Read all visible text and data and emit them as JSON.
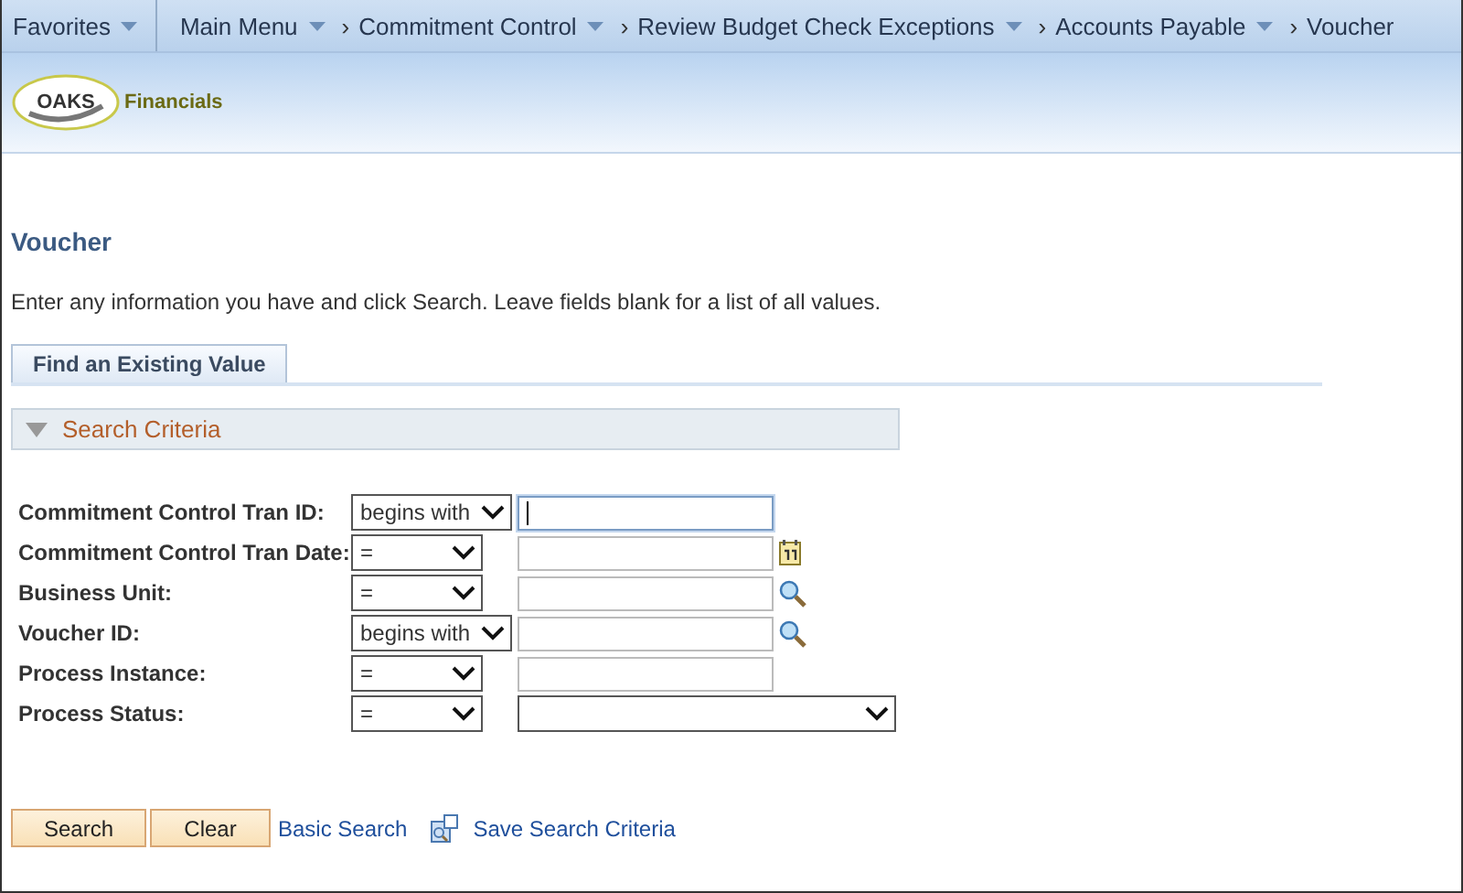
{
  "nav_bar": {
    "items": [
      {
        "label": "Favorites",
        "dropdown": true
      },
      {
        "label": "Main Menu",
        "dropdown": true
      },
      {
        "separator": "›",
        "label": "Commitment Control",
        "dropdown": true
      },
      {
        "separator": "›",
        "label": "Review Budget Check Exceptions",
        "dropdown": true
      },
      {
        "separator": "›",
        "label": "Accounts Payable",
        "dropdown": true
      },
      {
        "separator": "›",
        "label": "Voucher",
        "dropdown": false
      }
    ]
  },
  "header": {
    "logo_text": "OAKS",
    "logo_caption": "Financials"
  },
  "page": {
    "title": "Voucher",
    "instructions": "Enter any information you have and click Search. Leave fields blank for a list of all values."
  },
  "tabs": [
    {
      "label": "Find an Existing Value",
      "selected": true
    }
  ],
  "search_criteria": {
    "title": "Search Criteria",
    "expanded": true,
    "fields": [
      {
        "label": "Commitment Control Tran ID:",
        "operator": "begins with",
        "kind": "text",
        "focused": true
      },
      {
        "label": "Commitment Control Tran Date:",
        "operator": "=",
        "kind": "date",
        "focused": false
      },
      {
        "label": "Business Unit:",
        "operator": "=",
        "kind": "lookup",
        "focused": false
      },
      {
        "label": "Voucher ID:",
        "operator": "begins with",
        "kind": "lookup",
        "focused": false
      },
      {
        "label": "Process Instance:",
        "operator": "=",
        "kind": "text",
        "focused": false
      },
      {
        "label": "Process Status:",
        "operator": "=",
        "kind": "dropdown",
        "focused": false
      }
    ]
  },
  "buttons": [
    {
      "label": "Search"
    },
    {
      "label": "Clear"
    }
  ],
  "links": [
    {
      "label": "Basic Search",
      "kind": "plain"
    },
    {
      "label": "Save Search Criteria",
      "kind": "save"
    }
  ]
}
